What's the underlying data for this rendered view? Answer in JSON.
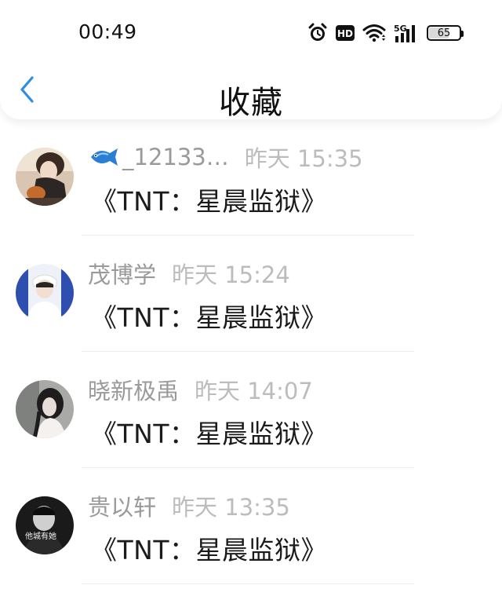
{
  "status_bar": {
    "time": "00:49",
    "hd_label": "HD",
    "network_label": "5G",
    "battery_level": "65",
    "battery_fraction": 0.65
  },
  "nav": {
    "title": "收藏",
    "back_icon": "chevron-left-icon",
    "accent_color": "#2e8ee0"
  },
  "items": [
    {
      "user_name": "_12133…",
      "name_prefix_icon": "fish-icon",
      "time": "昨天 15:35",
      "title": "《TNT：星晨监狱》"
    },
    {
      "user_name": "茂博学",
      "time": "昨天 15:24",
      "title": "《TNT：星晨监狱》"
    },
    {
      "user_name": "晓新极禹",
      "time": "昨天 14:07",
      "title": "《TNT：星晨监狱》"
    },
    {
      "user_name": "贵以轩",
      "time": "昨天 13:35",
      "title": "《TNT：星晨监狱》",
      "avatar_text": "他城有她"
    }
  ]
}
